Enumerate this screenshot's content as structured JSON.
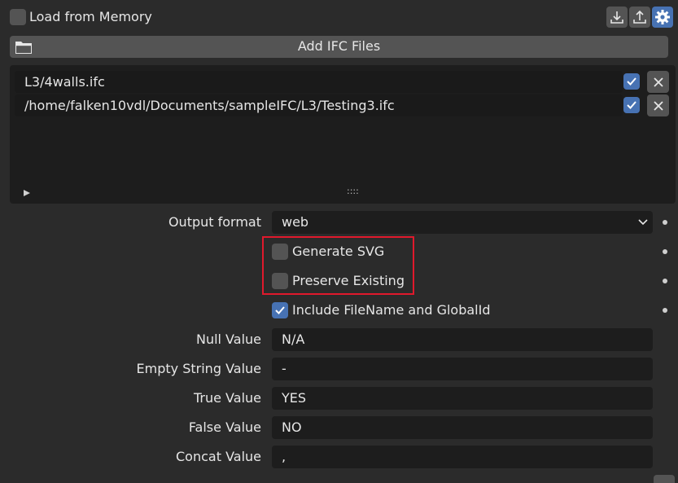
{
  "header": {
    "load_from_memory_label": "Load from Memory",
    "load_from_memory_checked": false
  },
  "toolbar": {
    "icons": [
      "download-icon",
      "upload-icon",
      "gear-icon"
    ]
  },
  "add_button": {
    "label": "Add IFC Files",
    "icon": "folder-icon"
  },
  "file_list": {
    "items": [
      {
        "path": "L3/4walls.ifc",
        "enabled": true
      },
      {
        "path": "/home/falken10vdl/Documents/sampleIFC/L3/Testing3.ifc",
        "enabled": true
      }
    ],
    "resize_handle": "::::"
  },
  "settings": {
    "output_format_label": "Output format",
    "output_format_value": "web",
    "generate_svg_label": "Generate SVG",
    "generate_svg_checked": false,
    "preserve_existing_label": "Preserve Existing",
    "preserve_existing_checked": false,
    "include_filename_label": "Include FileName and GlobalId",
    "include_filename_checked": true,
    "fields": [
      {
        "label": "Null Value",
        "value": "N/A"
      },
      {
        "label": "Empty String Value",
        "value": "-"
      },
      {
        "label": "True Value",
        "value": "YES"
      },
      {
        "label": "False Value",
        "value": "NO"
      },
      {
        "label": "Concat Value",
        "value": ","
      }
    ]
  },
  "colors": {
    "accent": "#4772b3",
    "highlight": "#e0192c",
    "background": "#2b2b2b",
    "field_bg": "#1d1d1d",
    "button_bg": "#545454"
  }
}
